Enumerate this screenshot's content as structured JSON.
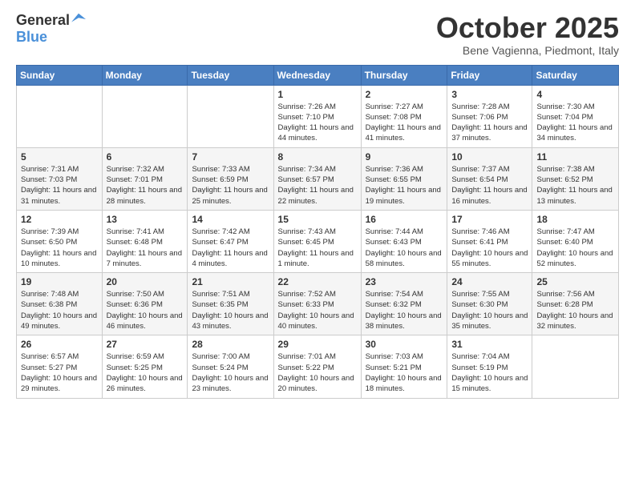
{
  "logo": {
    "general": "General",
    "blue": "Blue"
  },
  "header": {
    "month": "October 2025",
    "location": "Bene Vagienna, Piedmont, Italy"
  },
  "weekdays": [
    "Sunday",
    "Monday",
    "Tuesday",
    "Wednesday",
    "Thursday",
    "Friday",
    "Saturday"
  ],
  "weeks": [
    [
      {
        "day": "",
        "sunrise": "",
        "sunset": "",
        "daylight": ""
      },
      {
        "day": "",
        "sunrise": "",
        "sunset": "",
        "daylight": ""
      },
      {
        "day": "",
        "sunrise": "",
        "sunset": "",
        "daylight": ""
      },
      {
        "day": "1",
        "sunrise": "Sunrise: 7:26 AM",
        "sunset": "Sunset: 7:10 PM",
        "daylight": "Daylight: 11 hours and 44 minutes."
      },
      {
        "day": "2",
        "sunrise": "Sunrise: 7:27 AM",
        "sunset": "Sunset: 7:08 PM",
        "daylight": "Daylight: 11 hours and 41 minutes."
      },
      {
        "day": "3",
        "sunrise": "Sunrise: 7:28 AM",
        "sunset": "Sunset: 7:06 PM",
        "daylight": "Daylight: 11 hours and 37 minutes."
      },
      {
        "day": "4",
        "sunrise": "Sunrise: 7:30 AM",
        "sunset": "Sunset: 7:04 PM",
        "daylight": "Daylight: 11 hours and 34 minutes."
      }
    ],
    [
      {
        "day": "5",
        "sunrise": "Sunrise: 7:31 AM",
        "sunset": "Sunset: 7:03 PM",
        "daylight": "Daylight: 11 hours and 31 minutes."
      },
      {
        "day": "6",
        "sunrise": "Sunrise: 7:32 AM",
        "sunset": "Sunset: 7:01 PM",
        "daylight": "Daylight: 11 hours and 28 minutes."
      },
      {
        "day": "7",
        "sunrise": "Sunrise: 7:33 AM",
        "sunset": "Sunset: 6:59 PM",
        "daylight": "Daylight: 11 hours and 25 minutes."
      },
      {
        "day": "8",
        "sunrise": "Sunrise: 7:34 AM",
        "sunset": "Sunset: 6:57 PM",
        "daylight": "Daylight: 11 hours and 22 minutes."
      },
      {
        "day": "9",
        "sunrise": "Sunrise: 7:36 AM",
        "sunset": "Sunset: 6:55 PM",
        "daylight": "Daylight: 11 hours and 19 minutes."
      },
      {
        "day": "10",
        "sunrise": "Sunrise: 7:37 AM",
        "sunset": "Sunset: 6:54 PM",
        "daylight": "Daylight: 11 hours and 16 minutes."
      },
      {
        "day": "11",
        "sunrise": "Sunrise: 7:38 AM",
        "sunset": "Sunset: 6:52 PM",
        "daylight": "Daylight: 11 hours and 13 minutes."
      }
    ],
    [
      {
        "day": "12",
        "sunrise": "Sunrise: 7:39 AM",
        "sunset": "Sunset: 6:50 PM",
        "daylight": "Daylight: 11 hours and 10 minutes."
      },
      {
        "day": "13",
        "sunrise": "Sunrise: 7:41 AM",
        "sunset": "Sunset: 6:48 PM",
        "daylight": "Daylight: 11 hours and 7 minutes."
      },
      {
        "day": "14",
        "sunrise": "Sunrise: 7:42 AM",
        "sunset": "Sunset: 6:47 PM",
        "daylight": "Daylight: 11 hours and 4 minutes."
      },
      {
        "day": "15",
        "sunrise": "Sunrise: 7:43 AM",
        "sunset": "Sunset: 6:45 PM",
        "daylight": "Daylight: 11 hours and 1 minute."
      },
      {
        "day": "16",
        "sunrise": "Sunrise: 7:44 AM",
        "sunset": "Sunset: 6:43 PM",
        "daylight": "Daylight: 10 hours and 58 minutes."
      },
      {
        "day": "17",
        "sunrise": "Sunrise: 7:46 AM",
        "sunset": "Sunset: 6:41 PM",
        "daylight": "Daylight: 10 hours and 55 minutes."
      },
      {
        "day": "18",
        "sunrise": "Sunrise: 7:47 AM",
        "sunset": "Sunset: 6:40 PM",
        "daylight": "Daylight: 10 hours and 52 minutes."
      }
    ],
    [
      {
        "day": "19",
        "sunrise": "Sunrise: 7:48 AM",
        "sunset": "Sunset: 6:38 PM",
        "daylight": "Daylight: 10 hours and 49 minutes."
      },
      {
        "day": "20",
        "sunrise": "Sunrise: 7:50 AM",
        "sunset": "Sunset: 6:36 PM",
        "daylight": "Daylight: 10 hours and 46 minutes."
      },
      {
        "day": "21",
        "sunrise": "Sunrise: 7:51 AM",
        "sunset": "Sunset: 6:35 PM",
        "daylight": "Daylight: 10 hours and 43 minutes."
      },
      {
        "day": "22",
        "sunrise": "Sunrise: 7:52 AM",
        "sunset": "Sunset: 6:33 PM",
        "daylight": "Daylight: 10 hours and 40 minutes."
      },
      {
        "day": "23",
        "sunrise": "Sunrise: 7:54 AM",
        "sunset": "Sunset: 6:32 PM",
        "daylight": "Daylight: 10 hours and 38 minutes."
      },
      {
        "day": "24",
        "sunrise": "Sunrise: 7:55 AM",
        "sunset": "Sunset: 6:30 PM",
        "daylight": "Daylight: 10 hours and 35 minutes."
      },
      {
        "day": "25",
        "sunrise": "Sunrise: 7:56 AM",
        "sunset": "Sunset: 6:28 PM",
        "daylight": "Daylight: 10 hours and 32 minutes."
      }
    ],
    [
      {
        "day": "26",
        "sunrise": "Sunrise: 6:57 AM",
        "sunset": "Sunset: 5:27 PM",
        "daylight": "Daylight: 10 hours and 29 minutes."
      },
      {
        "day": "27",
        "sunrise": "Sunrise: 6:59 AM",
        "sunset": "Sunset: 5:25 PM",
        "daylight": "Daylight: 10 hours and 26 minutes."
      },
      {
        "day": "28",
        "sunrise": "Sunrise: 7:00 AM",
        "sunset": "Sunset: 5:24 PM",
        "daylight": "Daylight: 10 hours and 23 minutes."
      },
      {
        "day": "29",
        "sunrise": "Sunrise: 7:01 AM",
        "sunset": "Sunset: 5:22 PM",
        "daylight": "Daylight: 10 hours and 20 minutes."
      },
      {
        "day": "30",
        "sunrise": "Sunrise: 7:03 AM",
        "sunset": "Sunset: 5:21 PM",
        "daylight": "Daylight: 10 hours and 18 minutes."
      },
      {
        "day": "31",
        "sunrise": "Sunrise: 7:04 AM",
        "sunset": "Sunset: 5:19 PM",
        "daylight": "Daylight: 10 hours and 15 minutes."
      },
      {
        "day": "",
        "sunrise": "",
        "sunset": "",
        "daylight": ""
      }
    ]
  ]
}
